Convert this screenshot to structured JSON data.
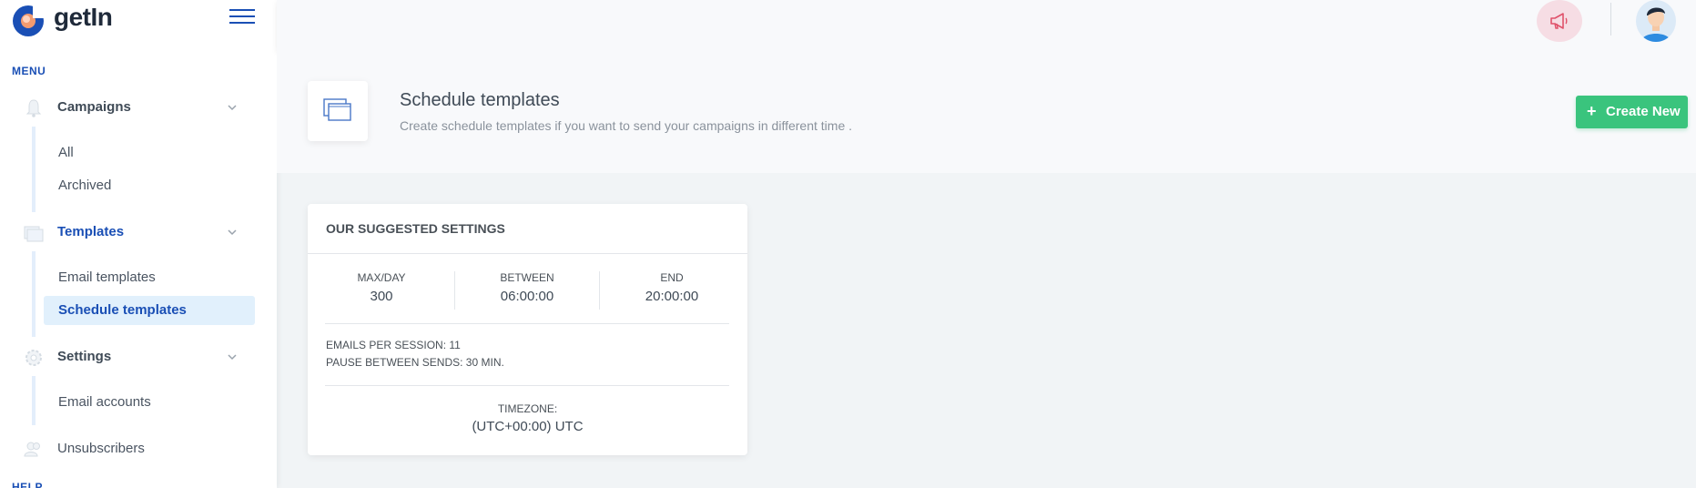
{
  "app": {
    "name": "getIn"
  },
  "sidebar": {
    "menu_title": "MENU",
    "groups": [
      {
        "label": "Campaigns",
        "icon": "bell-icon",
        "items": [
          "All",
          "Archived"
        ]
      },
      {
        "label": "Templates",
        "icon": "window-icon",
        "items": [
          "Email templates",
          "Schedule templates"
        ]
      },
      {
        "label": "Settings",
        "icon": "gear-icon",
        "items": [
          "Email accounts"
        ]
      }
    ],
    "unsubscribers": "Unsubscribers",
    "help_title": "HELP"
  },
  "topbar": {
    "notification_icon": "megaphone-icon",
    "avatar_icon": "user-avatar-icon"
  },
  "header": {
    "title": "Schedule templates",
    "subtitle": "Create schedule templates if you want to send your campaigns in different time .",
    "create_label": "Create New"
  },
  "card": {
    "title": "OUR SUGGESTED SETTINGS",
    "max_day_label": "MAX/DAY",
    "max_day_value": "300",
    "between_label": "BETWEEN",
    "between_value": "06:00:00",
    "end_label": "END",
    "end_value": "20:00:00",
    "emails_per_session": "EMAILS PER SESSION: 11",
    "pause_between_sends": "PAUSE BETWEEN SENDS: 30 MIN.",
    "timezone_label": "TIMEZONE:",
    "timezone_value": "(UTC+00:00) UTC"
  },
  "colors": {
    "brand": "#1a4fb5",
    "accent_green": "#3ac47d",
    "active_bg": "#e1f0fc"
  }
}
